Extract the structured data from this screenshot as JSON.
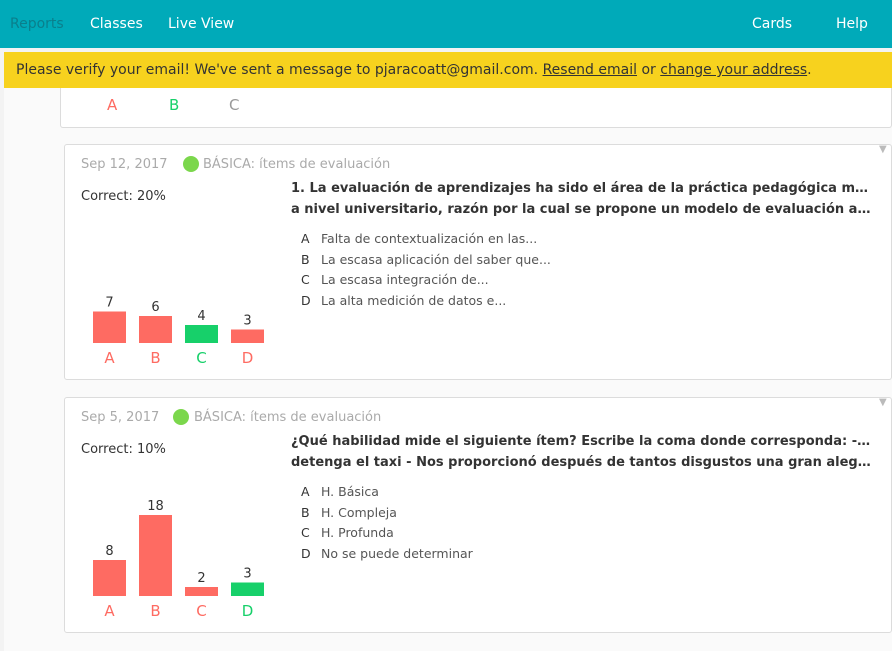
{
  "nav": {
    "reports": "Reports",
    "classes": "Classes",
    "live_view": "Live View",
    "cards": "Cards",
    "help": "Help"
  },
  "banner": {
    "text_before": "Please verify your email! We've sent a message to pjaracoatt@gmail.com.",
    "resend_link": "Resend email",
    "text_or": "or",
    "change_link": "change your address",
    "text_after": "."
  },
  "top_card": {
    "labels": [
      "A",
      "B",
      "C"
    ]
  },
  "cards": [
    {
      "date": "Sep 12, 2017",
      "category": "BÁSICA: ítems de evaluación",
      "correct": "Correct: 20%",
      "question_line1": "1. La evaluación de aprendizajes ha sido el área de la práctica pedagógica más deficitaria",
      "question_line2": "a nivel universitario, razón por la cual se propone un modelo de evaluación auté...",
      "options": [
        {
          "key": "A",
          "text": "Falta de contextualización en las..."
        },
        {
          "key": "B",
          "text": "La escasa aplicación del saber que..."
        },
        {
          "key": "C",
          "text": "La escasa integración de..."
        },
        {
          "key": "D",
          "text": "La alta medición de datos e..."
        }
      ]
    },
    {
      "date": "Sep 5, 2017",
      "category": "BÁSICA: ítems de evaluación",
      "correct": "Correct: 10%",
      "question_line1": "¿Qué habilidad mide el siguiente ítem? Escribe la coma donde corresponda: - Chofer",
      "question_line2": "detenga el taxi - Nos proporcionó después de tantos disgustos una gran alegría. - Gabri...",
      "options": [
        {
          "key": "A",
          "text": "H. Básica"
        },
        {
          "key": "B",
          "text": "H. Compleja"
        },
        {
          "key": "C",
          "text": "H. Profunda"
        },
        {
          "key": "D",
          "text": "No se puede determinar"
        }
      ]
    }
  ],
  "chart_data": [
    {
      "type": "bar",
      "categories": [
        "A",
        "B",
        "C",
        "D"
      ],
      "values": [
        7,
        6,
        4,
        3
      ],
      "correct": "C",
      "colors": {
        "incorrect": "#fe6b62",
        "correct": "#17d06a",
        "top_card_C": "#999999"
      },
      "ylim": [
        0,
        18
      ]
    },
    {
      "type": "bar",
      "categories": [
        "A",
        "B",
        "C",
        "D"
      ],
      "values": [
        8,
        18,
        2,
        3
      ],
      "correct": "D",
      "colors": {
        "incorrect": "#fe6b62",
        "correct": "#17d06a"
      },
      "ylim": [
        0,
        18
      ]
    }
  ]
}
